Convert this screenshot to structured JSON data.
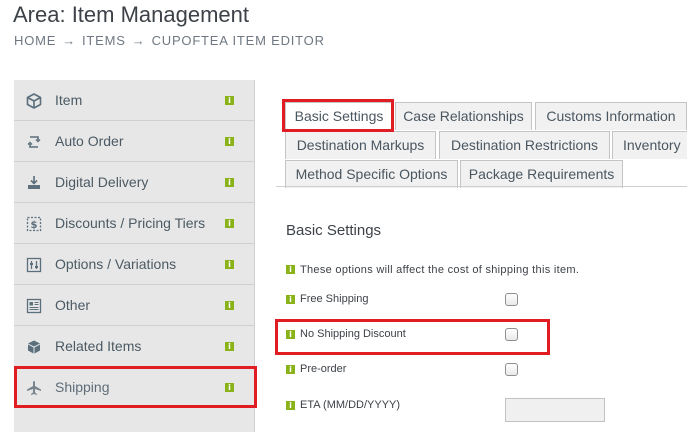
{
  "header": {
    "title": "Area: Item Management",
    "breadcrumb": [
      {
        "label": "HOME"
      },
      {
        "label": "ITEMS"
      },
      {
        "label": "CUPOFTEA ITEM EDITOR"
      }
    ],
    "separator": "→"
  },
  "sidebar": {
    "items": [
      {
        "label": "Item",
        "icon": "cube-icon"
      },
      {
        "label": "Auto Order",
        "icon": "repeat-icon"
      },
      {
        "label": "Digital Delivery",
        "icon": "download-icon"
      },
      {
        "label": "Discounts / Pricing Tiers",
        "icon": "dollar-icon"
      },
      {
        "label": "Options / Variations",
        "icon": "sliders-icon"
      },
      {
        "label": "Other",
        "icon": "list-icon"
      },
      {
        "label": "Related Items",
        "icon": "cubes-icon"
      },
      {
        "label": "Shipping",
        "icon": "plane-icon",
        "selected": true
      }
    ],
    "info_glyph": "i"
  },
  "tabs": {
    "row1": [
      "Basic Settings",
      "Case Relationships",
      "Customs Information"
    ],
    "row2": [
      "Destination Markups",
      "Destination Restrictions",
      "Inventory"
    ],
    "row3": [
      "Method Specific Options",
      "Package Requirements"
    ],
    "active": "Basic Settings"
  },
  "main": {
    "section_title": "Basic Settings",
    "note": "These options will affect the cost of shipping this item.",
    "fields": [
      {
        "label": "Free Shipping",
        "checked": false
      },
      {
        "label": "No Shipping Discount",
        "checked": false
      },
      {
        "label": "Pre-order",
        "checked": false
      },
      {
        "label": "ETA (MM/DD/YYYY)",
        "value": ""
      }
    ]
  },
  "colors": {
    "highlight": "#e01d23",
    "info_badge": "#8ab31a",
    "sidebar_bg": "#e7e7e7"
  }
}
